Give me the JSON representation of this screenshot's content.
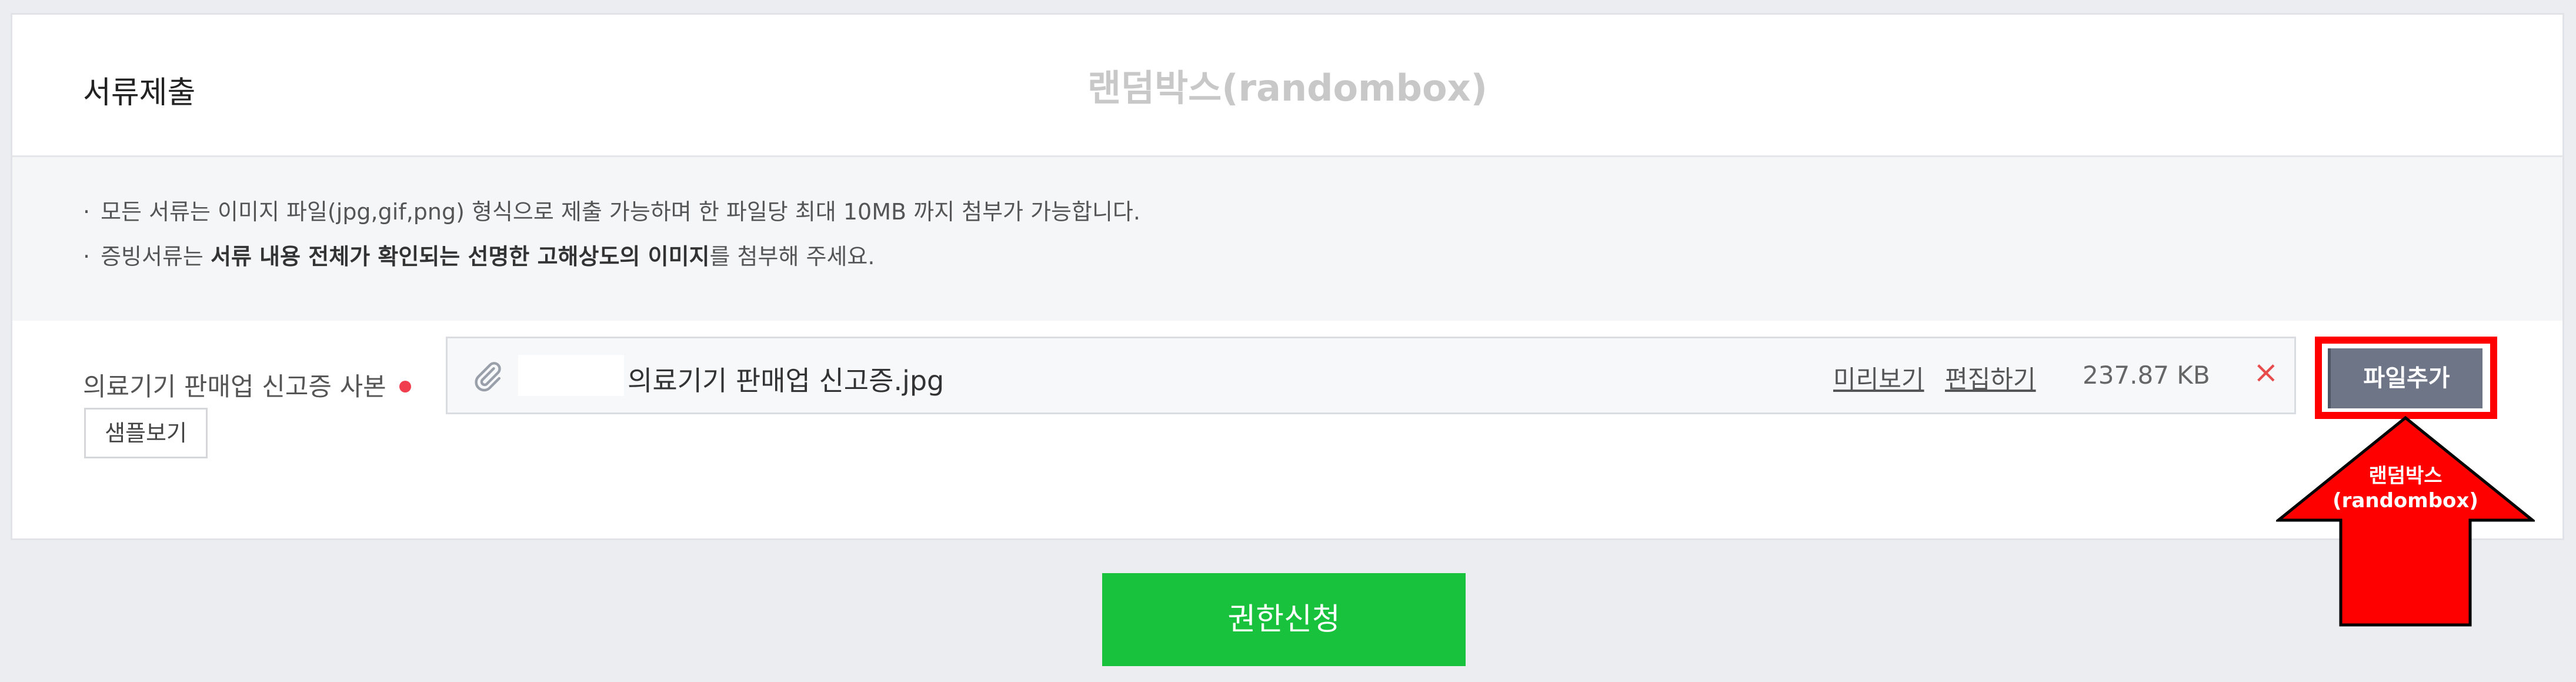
{
  "header": {
    "section_title": "서류제출",
    "watermark": "랜덤박스(randombox)"
  },
  "notice": {
    "line1": "모든 서류는 이미지 파일(jpg,gif,png) 형식으로 제출 가능하며 한 파일당 최대 10MB 까지 첨부가 가능합니다.",
    "line2_prefix": "증빙서류는 ",
    "line2_bold": "서류 내용 전체가 확인되는 선명한 고해상도의 이미지",
    "line2_suffix": "를 첨부해 주세요.",
    "bullet": "·"
  },
  "field": {
    "label": "의료기기 판매업 신고증 사본",
    "sample_button": "샘플보기",
    "file_name": "의료기기 판매업 신고증.jpg",
    "preview_link": "미리보기",
    "edit_link": "편집하기",
    "file_size": "237.87 KB",
    "remove_glyph": "×",
    "add_button": "파일추가"
  },
  "annotation": {
    "line1": "랜덤박스",
    "line2": "(randombox)"
  },
  "submit_button": "권한신청",
  "icons": [
    "paperclip-icon",
    "close-icon"
  ],
  "colors": {
    "background": "#ebedf1",
    "required": "#f03e4e",
    "submit": "#18c23c",
    "add_button": "#6d7586",
    "annotation": "#ff0000"
  }
}
